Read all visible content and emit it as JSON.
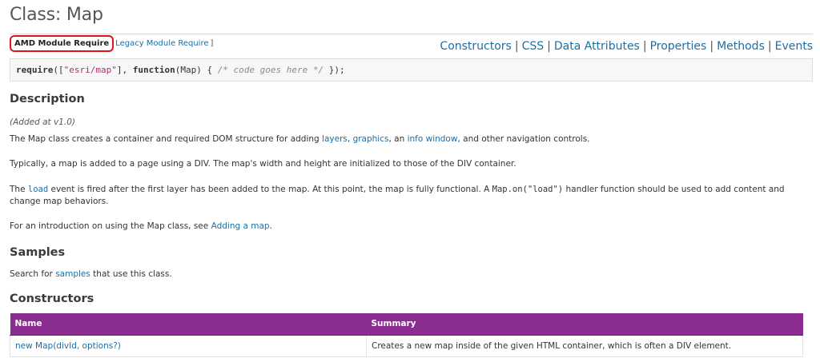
{
  "page": {
    "title": "Class: Map"
  },
  "require_tabs": {
    "amd_label": "AMD Module Require",
    "legacy_label": "Legacy Module Require",
    "closing": "]"
  },
  "section_nav": {
    "items": [
      "Constructors",
      "CSS",
      "Data Attributes",
      "Properties",
      "Methods",
      "Events"
    ],
    "separator": "|"
  },
  "code_snippet": {
    "kw_require": "require",
    "open": "([",
    "str_module": "\"esri/map\"",
    "comma": "], ",
    "kw_function": "function",
    "params": "(Map) { ",
    "comment": "/* code goes here */",
    "close": " });"
  },
  "description": {
    "heading": "Description",
    "added": "(Added at v1.0)",
    "p1_before": "The Map class creates a container and required DOM structure for adding ",
    "p1_link1": "layers",
    "p1_sep1": ", ",
    "p1_link2": "graphics",
    "p1_sep2": ", an ",
    "p1_link3": "info window",
    "p1_after": ", and other navigation controls.",
    "p2": "Typically, a map is added to a page using a DIV. The map's width and height are initialized to those of the DIV container.",
    "p3_before": "The ",
    "p3_code1": "load",
    "p3_mid": " event is fired after the first layer has been added to the map. At this point, the map is fully functional. A ",
    "p3_code2": "Map.on(\"load\")",
    "p3_after": " handler function should be used to add content and change map behaviors.",
    "p4_before": "For an introduction on using the Map class, see ",
    "p4_link": "Adding a map",
    "p4_after": "."
  },
  "samples": {
    "heading": "Samples",
    "text_before": "Search for ",
    "link": "samples",
    "text_after": " that use this class."
  },
  "constructors": {
    "heading": "Constructors",
    "columns": [
      "Name",
      "Summary"
    ],
    "rows": [
      {
        "name": "new Map(divId, options?)",
        "summary": "Creates a new map inside of the given HTML container, which is often a DIV element."
      }
    ]
  },
  "colors": {
    "table_header": "#8b2c91",
    "link": "#1a6fa8",
    "highlight_box": "#e0151b"
  }
}
